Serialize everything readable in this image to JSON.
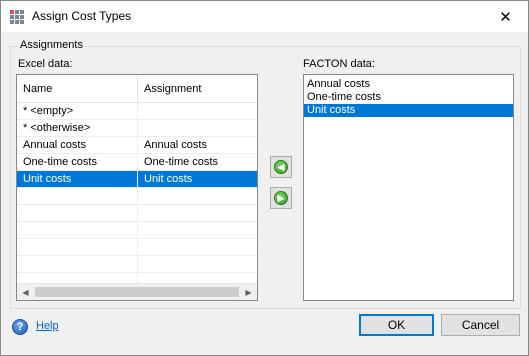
{
  "window": {
    "title": "Assign Cost Types",
    "close_glyph": "✕",
    "icon": "app-grid-icon"
  },
  "group": {
    "label": "Assignments"
  },
  "excel": {
    "label": "Excel data:",
    "columns": [
      "Name",
      "Assignment"
    ],
    "rows": [
      {
        "name": "* <empty>",
        "assignment": "",
        "selected": false
      },
      {
        "name": "* <otherwise>",
        "assignment": "",
        "selected": false
      },
      {
        "name": "Annual costs",
        "assignment": "Annual costs",
        "selected": false
      },
      {
        "name": "One-time costs",
        "assignment": "One-time costs",
        "selected": false
      },
      {
        "name": "Unit costs",
        "assignment": "Unit costs",
        "selected": true
      }
    ],
    "empty_rows": 6
  },
  "arrows": {
    "left_icon": "green-arrow-left-icon",
    "right_icon": "green-arrow-right-icon",
    "left_glyph": "◀",
    "right_glyph": "▶"
  },
  "facton": {
    "label": "FACTON data:",
    "items": [
      {
        "label": "Annual costs",
        "selected": false
      },
      {
        "label": "One-time costs",
        "selected": false
      },
      {
        "label": "Unit costs",
        "selected": true
      }
    ]
  },
  "footer": {
    "help_label": "Help",
    "help_glyph": "?",
    "ok_label": "OK",
    "cancel_label": "Cancel"
  },
  "colors": {
    "selection": "#0078d7",
    "background": "#f0f0f0",
    "link": "#0066cc"
  }
}
